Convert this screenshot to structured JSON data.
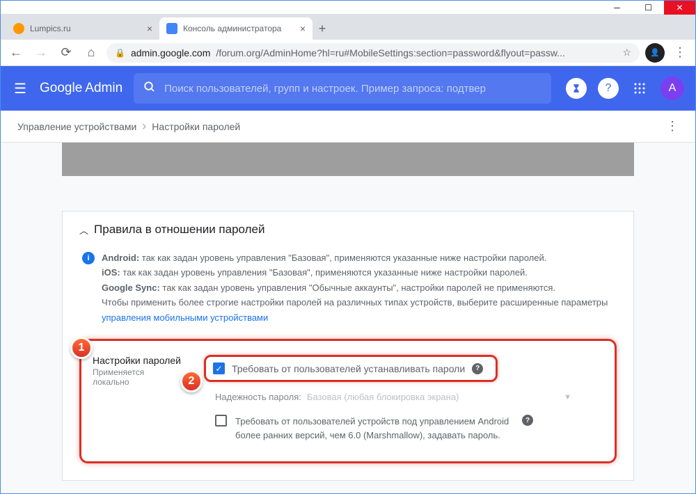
{
  "tabs": [
    {
      "title": "Lumpics.ru"
    },
    {
      "title": "Консоль администратора"
    }
  ],
  "url": {
    "domain": "admin.google.com",
    "path": "/forum.org/AdminHome?hl=ru#MobileSettings:section=password&flyout=passw..."
  },
  "admin_header": {
    "logo_google": "Google",
    "logo_admin": "Admin",
    "search_placeholder": "Поиск пользователей, групп и настроек. Пример запроса: подтвер",
    "avatar_letter": "A"
  },
  "breadcrumb": {
    "item1": "Управление устройствами",
    "item2": "Настройки паролей"
  },
  "section": {
    "title": "Правила в отношении паролей",
    "info_android_label": "Android:",
    "info_android_text": " так как задан уровень управления \"Базовая\", применяются указанные ниже настройки паролей.",
    "info_ios_label": "iOS:",
    "info_ios_text": " так как задан уровень управления \"Базовая\", применяются указанные ниже настройки паролей.",
    "info_sync_label": "Google Sync:",
    "info_sync_text": " так как задан уровень управления \"Обычные аккаунты\", настройки паролей не применяются.",
    "info_extra": "Чтобы применить более строгие настройки паролей на различных типах устройств, выберите расширенные параметры ",
    "info_link": "управления мобильными устройствами"
  },
  "settings": {
    "label": "Настройки паролей",
    "sublabel": "Применяется локально",
    "cb1_label": "Требовать от пользователей устанавливать пароли",
    "strength_label": "Надежность пароля:",
    "strength_value": "Базовая (любая блокировка экрана)",
    "cb2_label": "Требовать от пользователей устройств под управлением Android более ранних версий, чем 6.0 (Marshmallow), задавать пароль."
  },
  "markers": {
    "m1": "1",
    "m2": "2"
  }
}
